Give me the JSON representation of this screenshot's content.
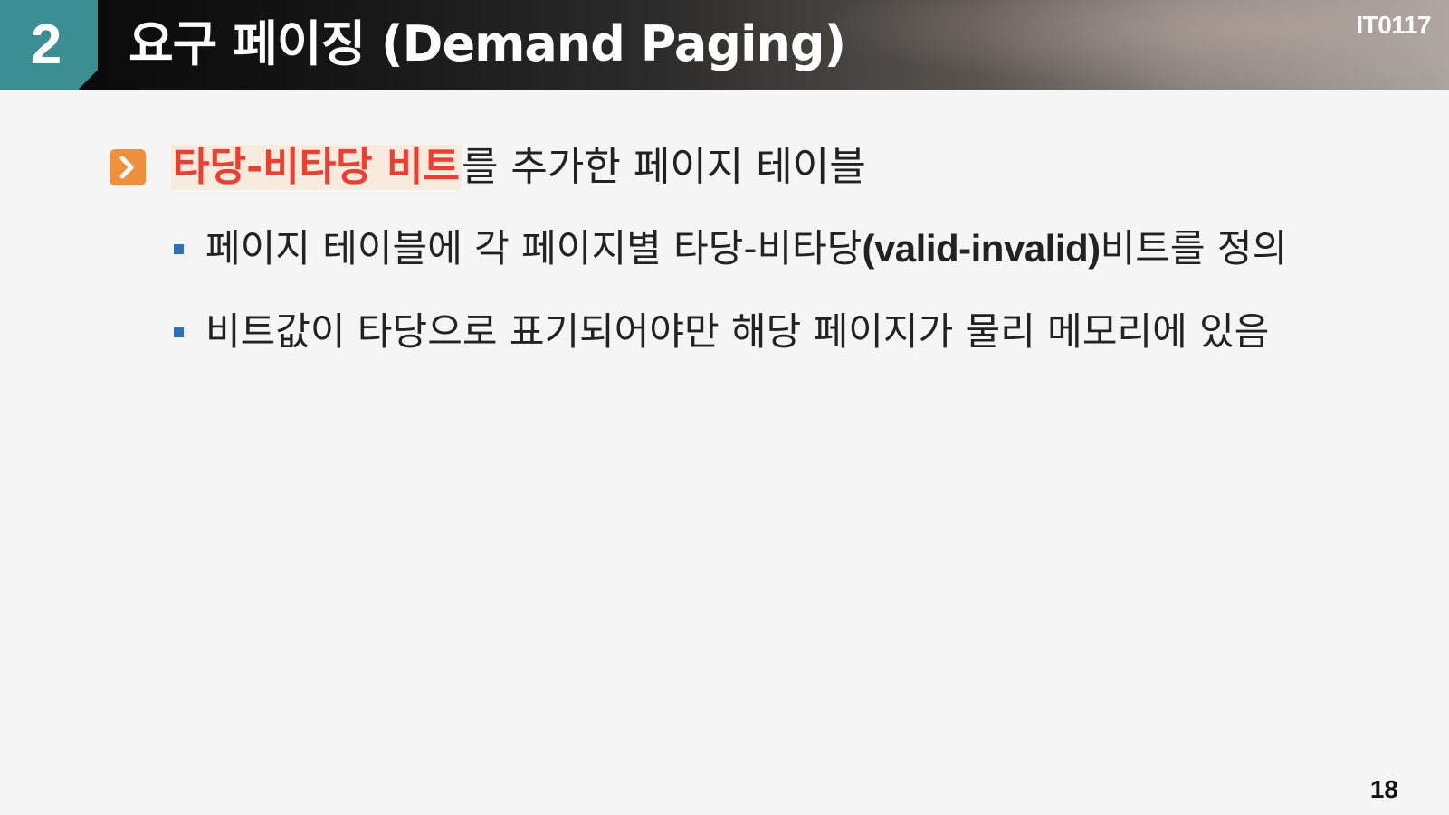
{
  "header": {
    "section_number": "2",
    "title": "요구 페이징 (Demand Paging)",
    "course_code": "IT0117"
  },
  "main_point": {
    "highlight": "타당-비타당 비트",
    "rest": "를 추가한 페이지 테이블",
    "highlight_color": "#ef3d2f",
    "icon": "chevron-right-icon"
  },
  "sub_points": [
    {
      "before": "페이지 테이블에 각 페이지별 타당-비타당",
      "emphasis": "(valid-invalid)",
      "after": "비트를 정의"
    },
    {
      "before": "비트값이 타당으로 표기되어야만 해당 페이지가 물리 메모리에 있음",
      "emphasis": "",
      "after": ""
    }
  ],
  "footer": {
    "page_number": "18"
  },
  "colors": {
    "accent_teal": "#3b8f93",
    "icon_orange": "#f0903c",
    "bullet_blue": "#2f6fb3"
  }
}
